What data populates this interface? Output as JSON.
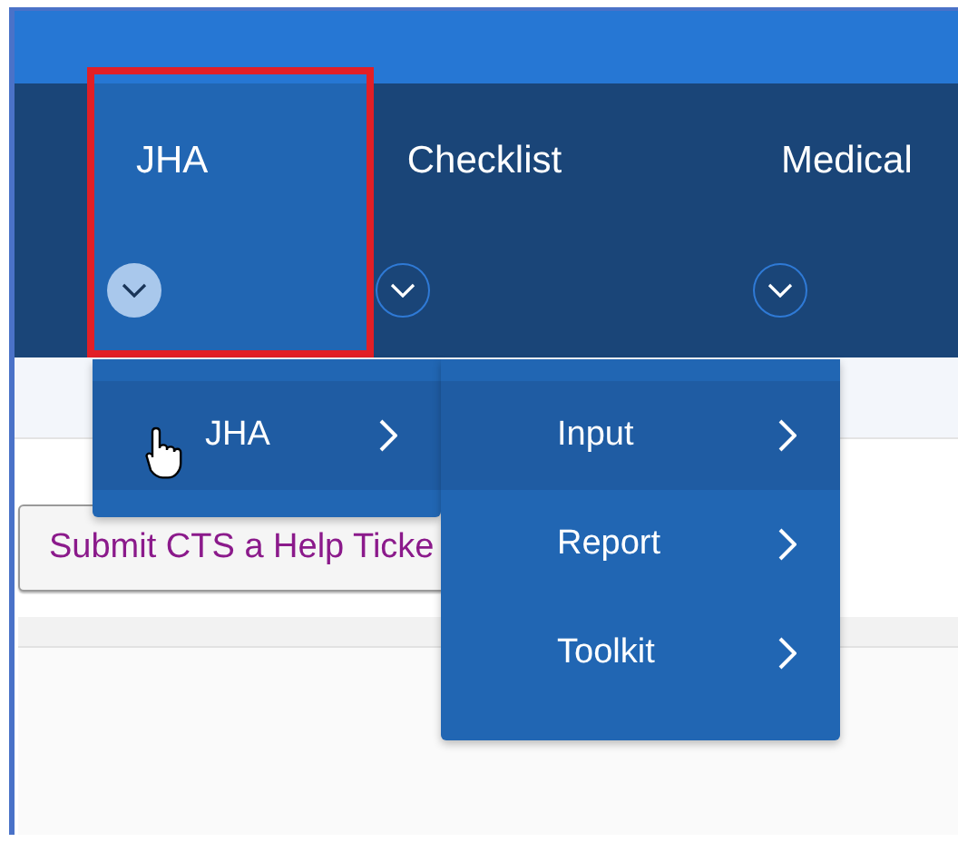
{
  "nav": {
    "tabs": [
      {
        "label": "JHA",
        "selected": true,
        "expanded": true,
        "highlighted": true
      },
      {
        "label": "Checklist",
        "selected": false,
        "expanded": false,
        "highlighted": false
      },
      {
        "label": "Medical",
        "selected": false,
        "expanded": false,
        "highlighted": false
      }
    ]
  },
  "menu": {
    "items": [
      {
        "label": "JHA",
        "selected": true
      }
    ]
  },
  "submenu": {
    "items": [
      {
        "label": "Input",
        "selected": true
      },
      {
        "label": "Report",
        "selected": false
      },
      {
        "label": "Toolkit",
        "selected": false
      }
    ]
  },
  "help_button": {
    "label": "Submit CTS a Help Ticke"
  }
}
